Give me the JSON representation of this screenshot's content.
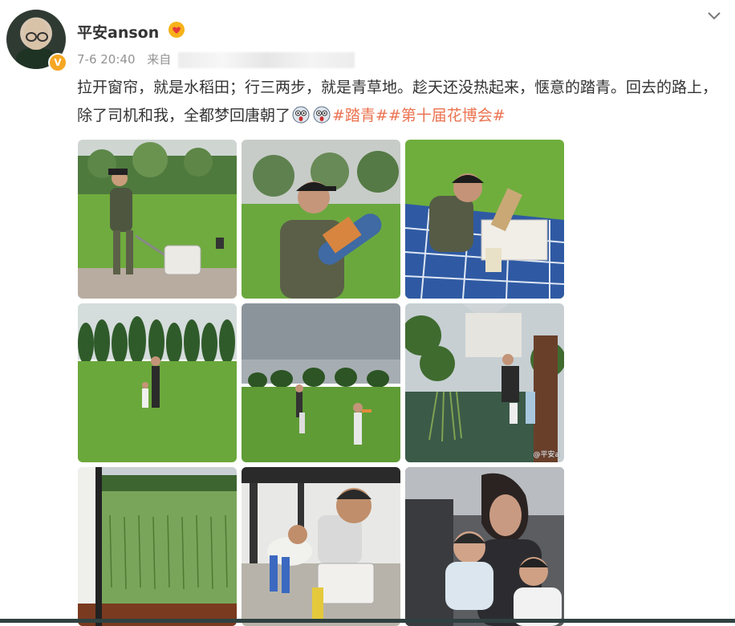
{
  "post": {
    "username": "平安anson",
    "timestamp": "7-6 20:40",
    "source_prefix": "来自",
    "text": "拉开窗帘，就是水稻田；行三两步，就是青草地。趁天还没热起来，惬意的踏青。回去的路上，除了司机和我，全都梦回唐朝了",
    "topics": [
      "#踏青#",
      "#第十届花博会#"
    ],
    "watermark": "@平安a"
  },
  "colors": {
    "topic": "#eb7350",
    "verified": "#f6a623",
    "meta": "#939393"
  },
  "icons": [
    "avatar",
    "verified-badge-icon",
    "vip-heart-icon",
    "chevron-down-icon",
    "sleeping-emoji-icon"
  ],
  "photos": [
    "man-pulling-cooler-on-lawn",
    "man-holding-picnic-mat",
    "man-unpacking-picnic-on-blanket",
    "woman-child-on-field-with-trees",
    "children-playing-on-lawn-cloudy",
    "woman-children-by-pond",
    "rice-paddy-through-window",
    "kids-with-cooler-on-porch",
    "sleeping-kids-in-car"
  ]
}
